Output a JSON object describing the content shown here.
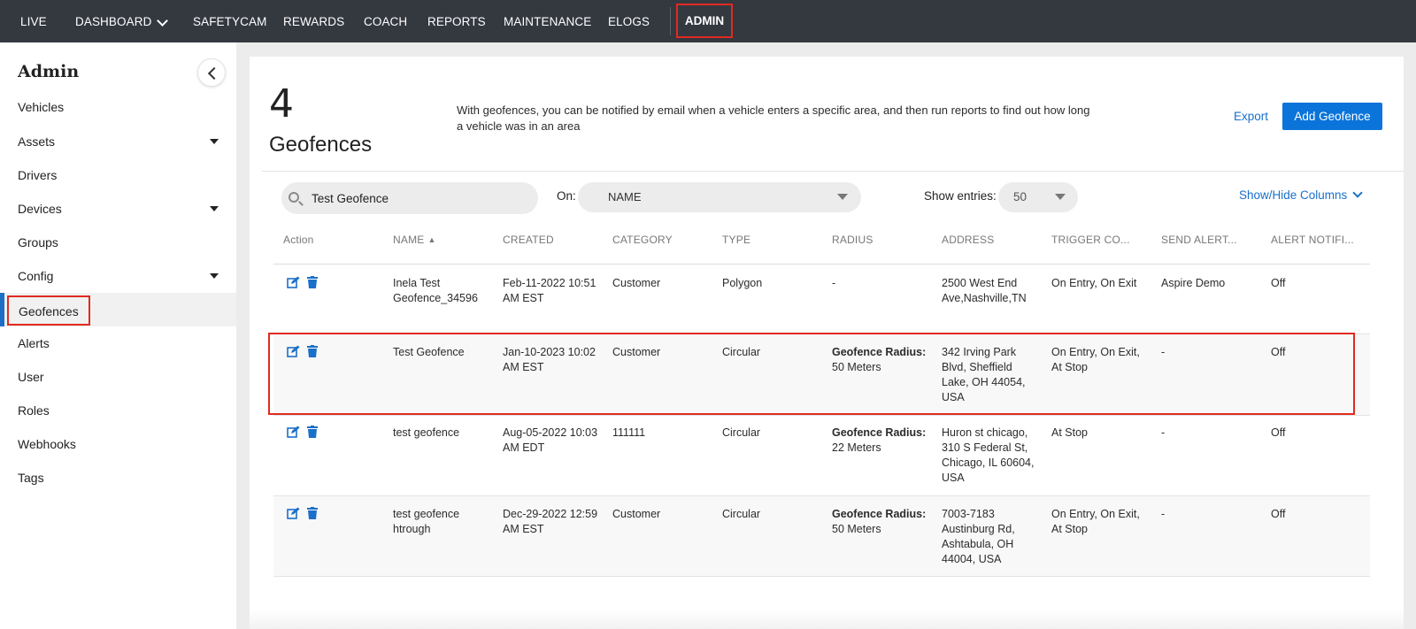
{
  "topnav": {
    "items": [
      "LIVE",
      "DASHBOARD",
      "SAFETYCAM",
      "REWARDS",
      "COACH",
      "REPORTS",
      "MAINTENANCE",
      "ELOGS"
    ],
    "active": "ADMIN"
  },
  "sidebar": {
    "title": "Admin",
    "items": [
      {
        "label": "Vehicles"
      },
      {
        "label": "Assets"
      },
      {
        "label": "Drivers"
      },
      {
        "label": "Devices"
      },
      {
        "label": "Groups"
      },
      {
        "label": "Config"
      },
      {
        "label": "Geofences"
      },
      {
        "label": "Alerts"
      },
      {
        "label": "User"
      },
      {
        "label": "Roles"
      },
      {
        "label": "Webhooks"
      },
      {
        "label": "Tags"
      }
    ]
  },
  "header": {
    "count": "4",
    "label": "Geofences",
    "description": "With geofences, you can be notified by email when a vehicle enters a specific area, and then run reports to find out how long a vehicle was in an area",
    "export": "Export",
    "add_button": "Add Geofence"
  },
  "filters": {
    "search_value": "Test Geofence",
    "on_label": "On:",
    "on_value": "NAME",
    "show_label": "Show entries:",
    "show_value": "50",
    "show_hide": "Show/Hide Columns"
  },
  "table": {
    "columns": [
      "Action",
      "NAME",
      "CREATED",
      "CATEGORY",
      "TYPE",
      "RADIUS",
      "ADDRESS",
      "TRIGGER CO...",
      "SEND ALERT...",
      "ALERT NOTIFI..."
    ],
    "radius_label": "Geofence Radius:",
    "rows": [
      {
        "name": "Inela Test Geofence_34596",
        "created": "Feb-11-2022 10:51 AM EST",
        "category": "Customer",
        "type": "Polygon",
        "radius": "-",
        "address": "2500 West End Ave,Nashville,TN",
        "trigger": "On Entry, On Exit",
        "send_alert": "Aspire Demo",
        "alert_notification": "Off"
      },
      {
        "name": "Test Geofence",
        "created": "Jan-10-2023 10:02 AM EST",
        "category": "Customer",
        "type": "Circular",
        "radius": "50 Meters",
        "address": "342 Irving Park Blvd, Sheffield Lake, OH 44054, USA",
        "trigger": "On Entry, On Exit, At Stop",
        "send_alert": "-",
        "alert_notification": "Off"
      },
      {
        "name": "test geofence",
        "created": "Aug-05-2022 10:03 AM EDT",
        "category": "111111",
        "type": "Circular",
        "radius": "22 Meters",
        "address": "Huron st chicago, 310 S Federal St, Chicago, IL 60604, USA",
        "trigger": "At Stop",
        "send_alert": "-",
        "alert_notification": "Off"
      },
      {
        "name": "test geofence htrough",
        "created": "Dec-29-2022 12:59 AM EST",
        "category": "Customer",
        "type": "Circular",
        "radius": "50 Meters",
        "address": "7003-7183 Austinburg Rd, Ashtabula, OH 44004, USA",
        "trigger": "On Entry, On Exit, At Stop",
        "send_alert": "-",
        "alert_notification": "Off"
      }
    ]
  },
  "colors": {
    "nav_bg": "#34383f",
    "accent_blue": "#0a74da",
    "highlight_red": "#e02b20",
    "active_bar": "#1c6fc5"
  },
  "icons": {
    "edit": "edit-icon",
    "delete": "trash-icon",
    "search": "search-icon"
  }
}
